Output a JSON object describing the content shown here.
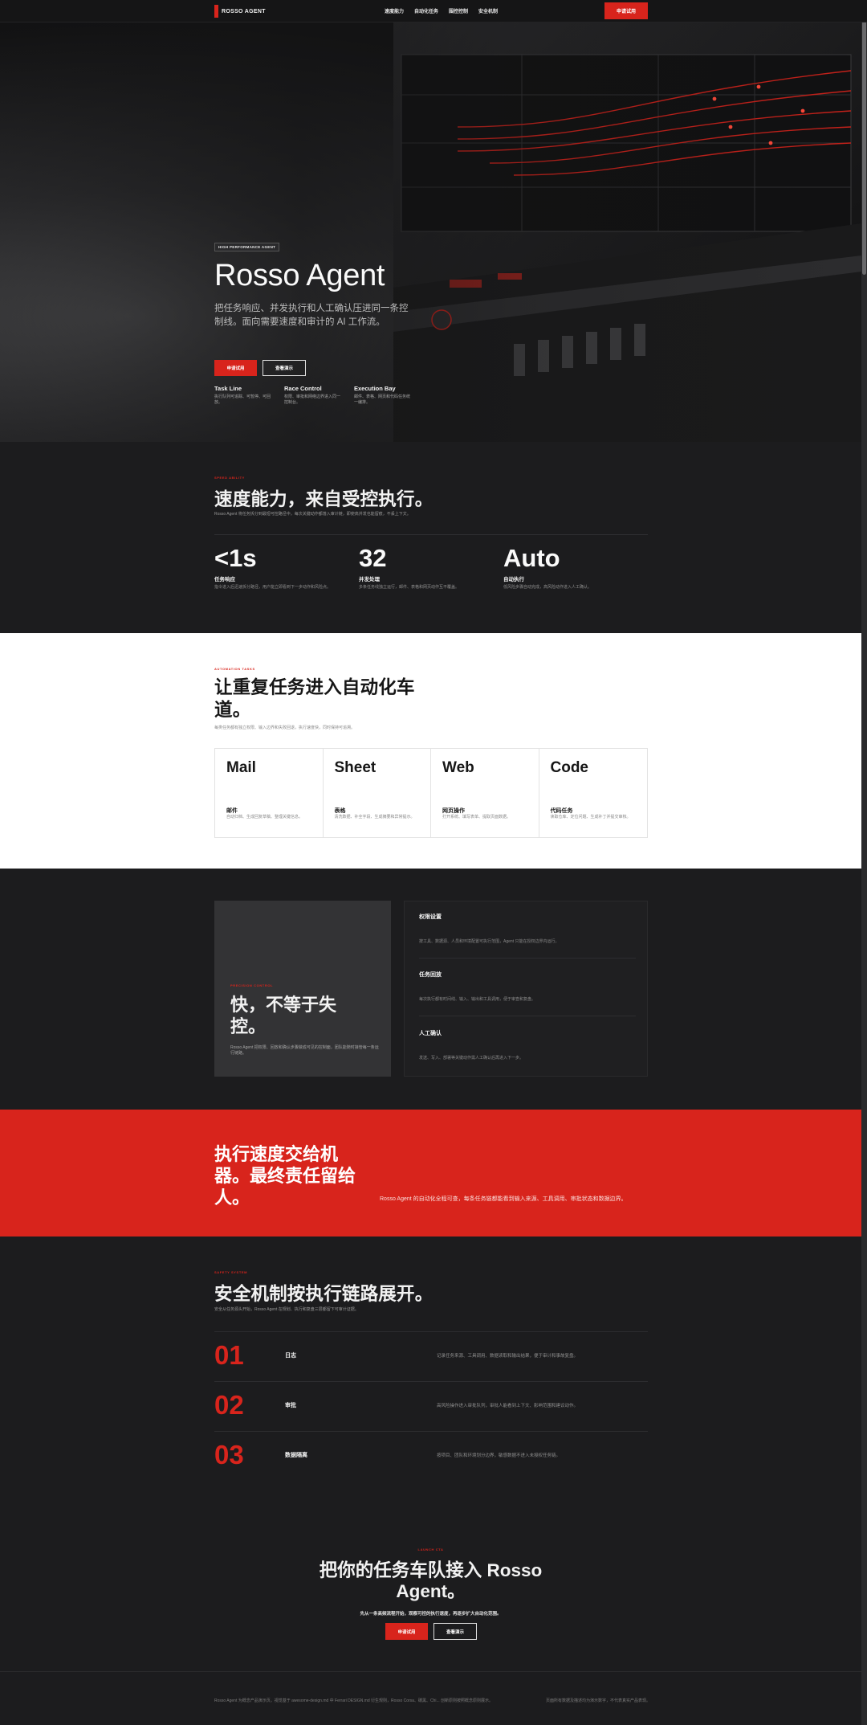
{
  "nav": {
    "brand": "ROSSO AGENT",
    "links": [
      "速度能力",
      "自动化任务",
      "围控控制",
      "安全机制"
    ],
    "cta": "申请试用"
  },
  "hero": {
    "kicker": "HIGH PERFORMANCE AGENT",
    "title": "Rosso Agent",
    "desc": "把任务响应、并发执行和人工确认压进同一条控制线。面向需要速度和审计的 AI 工作流。",
    "primary": "申请试用",
    "secondary": "查看演示",
    "features": [
      {
        "title": "Task Line",
        "desc": "执行队列可追踪、可暂停、可回放。"
      },
      {
        "title": "Race Control",
        "desc": "权限、审批和网络边界进入同一控制台。"
      },
      {
        "title": "Execution Bay",
        "desc": "邮件、表格、网页和代码任务统一编排。"
      }
    ]
  },
  "speed": {
    "eyebrow": "SPEED ABILITY",
    "title": "速度能力，来自受控执行。",
    "sub": "Rosso Agent 将任务拆分到最短可控路径中，每次关键动作都落入审计链，即使高并发也能留痕，不丢上下文。",
    "stats": [
      {
        "num": "<1s",
        "label": "任务响应",
        "desc": "指令进入后迅速拆分路径，用户能立即看到下一步动作和风险点。"
      },
      {
        "num": "32",
        "label": "并发处理",
        "desc": "多条任务线独立运行，邮件、表格和网页动作互不覆盖。"
      },
      {
        "num": "Auto",
        "label": "自动执行",
        "desc": "低风险步骤自动完成，高风险动作进入人工确认。"
      }
    ]
  },
  "automation": {
    "eyebrow": "AUTOMATION TASKS",
    "title": "让重复任务进入自动化车道。",
    "sub": "每类任务都有独立权限、输入边界和失败回退，执行速度快，同时保持可追溯。",
    "cards": [
      {
        "name": "Mail",
        "label": "邮件",
        "desc": "自动归档、生成回复草稿、整理关键信息。"
      },
      {
        "name": "Sheet",
        "label": "表格",
        "desc": "清洗数据、补全字段、生成摘要和异常提示。"
      },
      {
        "name": "Web",
        "label": "网页操作",
        "desc": "打开系统、填写表单、提取页面数据。"
      },
      {
        "name": "Code",
        "label": "代码任务",
        "desc": "读取仓库、定位问题、生成补丁并提交审核。"
      }
    ]
  },
  "control": {
    "eyebrow": "PRECISION CONTROL",
    "title": "快，不等于失控。",
    "desc": "Rosso Agent 把权限、回放和确认步骤做成可见的控制面，团队能随时接管每一条运行链路。",
    "items": [
      {
        "title": "权限设置",
        "desc": "按工具、数据源、人员和环境配置可执行范围，Agent 只能在授权边界内运行。"
      },
      {
        "title": "任务回放",
        "desc": "每次执行都有时间线、输入、输出和工具调用，便于审查和复盘。"
      },
      {
        "title": "人工确认",
        "desc": "发送、写入、部署等关键动作需人工确认后再进入下一步。"
      }
    ]
  },
  "banner": {
    "title": "执行速度交给机器。最终责任留给人。",
    "text": "Rosso Agent 的自动化全程可查，每条任务链都能看到输入来源、工具调用、审批状态和数据边界。"
  },
  "security": {
    "eyebrow": "SAFETY SYSTEM",
    "title": "安全机制按执行链路展开。",
    "sub": "安全从任务源头开始，Rosso Agent 在规划、执行和复盘三层都留下可审计证据。",
    "steps": [
      {
        "num": "01",
        "name": "日志",
        "desc": "记录任务来源、工具调用、数据读取和输出结果，便于审计和事故复盘。"
      },
      {
        "num": "02",
        "name": "审批",
        "desc": "高风险操作进入审批队列，审批人能看到上下文、影响范围和建议动作。"
      },
      {
        "num": "03",
        "name": "数据隔离",
        "desc": "按项目、团队和环境划分边界，敏感数据不进入未授权任务链。"
      }
    ]
  },
  "cta": {
    "eyebrow": "LAUNCH CTA",
    "title": "把你的任务车队接入 Rosso Agent。",
    "sub": "先从一条高频流程开始，观察可控的执行速度，再逐步扩大自动化范围。",
    "primary": "申请试用",
    "secondary": "查看演示"
  },
  "footer": {
    "left": "Rosso Agent 为概念产品演示页。视觉基于 awesome-design.md 中 Ferrari DESIGN.md 衍生规则，Rosso Corsa、碳黑、Chi... 创新原则按照概念原则展示。",
    "right": "页面所有数据及描述均为演示数字，不代表真实产品表现。"
  },
  "colors": {
    "accent": "#d8241c",
    "dark": "#1c1c1e",
    "light": "#ffffff"
  }
}
